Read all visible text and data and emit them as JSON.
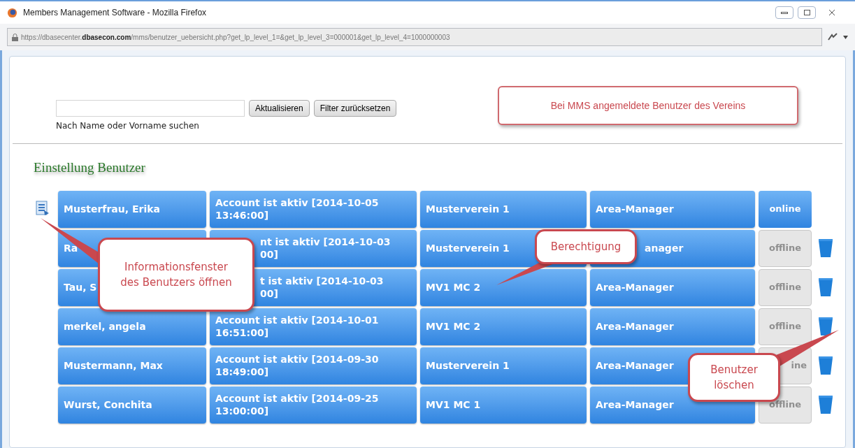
{
  "window": {
    "title": "Members Management Software - Mozilla Firefox"
  },
  "address_bar": {
    "url": "https://dbasecenter.**dbasecon.com**/mms/benutzer_uebersicht.php?get_lp_level_1=&get_lp_level_3=000001&get_lp_level_4=1000000003"
  },
  "search": {
    "hint": "Nach Name oder Vorname suchen",
    "buttons": [
      "Aktualisieren",
      "Filter zurücksetzen"
    ]
  },
  "heading": "Einstellung Benutzer",
  "rows": [
    {
      "kind": "normal",
      "info_icon": true,
      "name": "Musterfrau, Erika",
      "status": [
        "Account ist aktiv [2014-10-05",
        "13:46:00]"
      ],
      "club": "Musterverein 1",
      "role": "Area-Manager",
      "online": true,
      "state_label": "online"
    },
    {
      "kind": "behind-callouts",
      "info_icon": false,
      "name": "Ra",
      "status": [
        "nt ist aktiv [2014-10-03",
        "00]"
      ],
      "club": "Musterverein 1",
      "role": "anager",
      "online": false,
      "state_label": "offline"
    },
    {
      "kind": "behind-left-callout",
      "info_icon": false,
      "name": "Tau, S",
      "status": [
        "t ist aktiv [2014-10-03",
        "00]"
      ],
      "club": "MV1 MC 2",
      "role": "Area-Manager",
      "online": false,
      "state_label": "offline"
    },
    {
      "kind": "normal",
      "info_icon": false,
      "name": "merkel, angela",
      "status": [
        "Account ist aktiv [2014-10-01",
        "16:51:00]"
      ],
      "club": "MV1 MC 2",
      "role": "Area-Manager",
      "online": false,
      "state_label": "offline"
    },
    {
      "kind": "behind-right-callout",
      "info_icon": false,
      "name": "Mustermann, Max",
      "status": [
        "Account ist aktiv [2014-09-30",
        "18:49:00]"
      ],
      "club": "Musterverein 1",
      "role": "Area-Manager",
      "online": false,
      "state_label": "ine"
    },
    {
      "kind": "normal",
      "info_icon": false,
      "name": "Wurst, Conchita",
      "status": [
        "Account ist aktiv [2014-09-25",
        "13:00:00]"
      ],
      "club": "MV1 MC 1",
      "role": "Area-Manager",
      "online": false,
      "state_label": "offline"
    }
  ],
  "callouts": [
    {
      "kind": "top-banner",
      "text": "Bei MMS angemeldete Benutzer des Vereins"
    },
    {
      "kind": "info-pointer",
      "lines": [
        "Informationsfenster",
        "des Benutzers öffnen"
      ]
    },
    {
      "kind": "permission-pointer",
      "lines": [
        "Berechtigung"
      ]
    },
    {
      "kind": "delete-pointer",
      "lines": [
        "Benutzer",
        "löschen"
      ]
    }
  ]
}
